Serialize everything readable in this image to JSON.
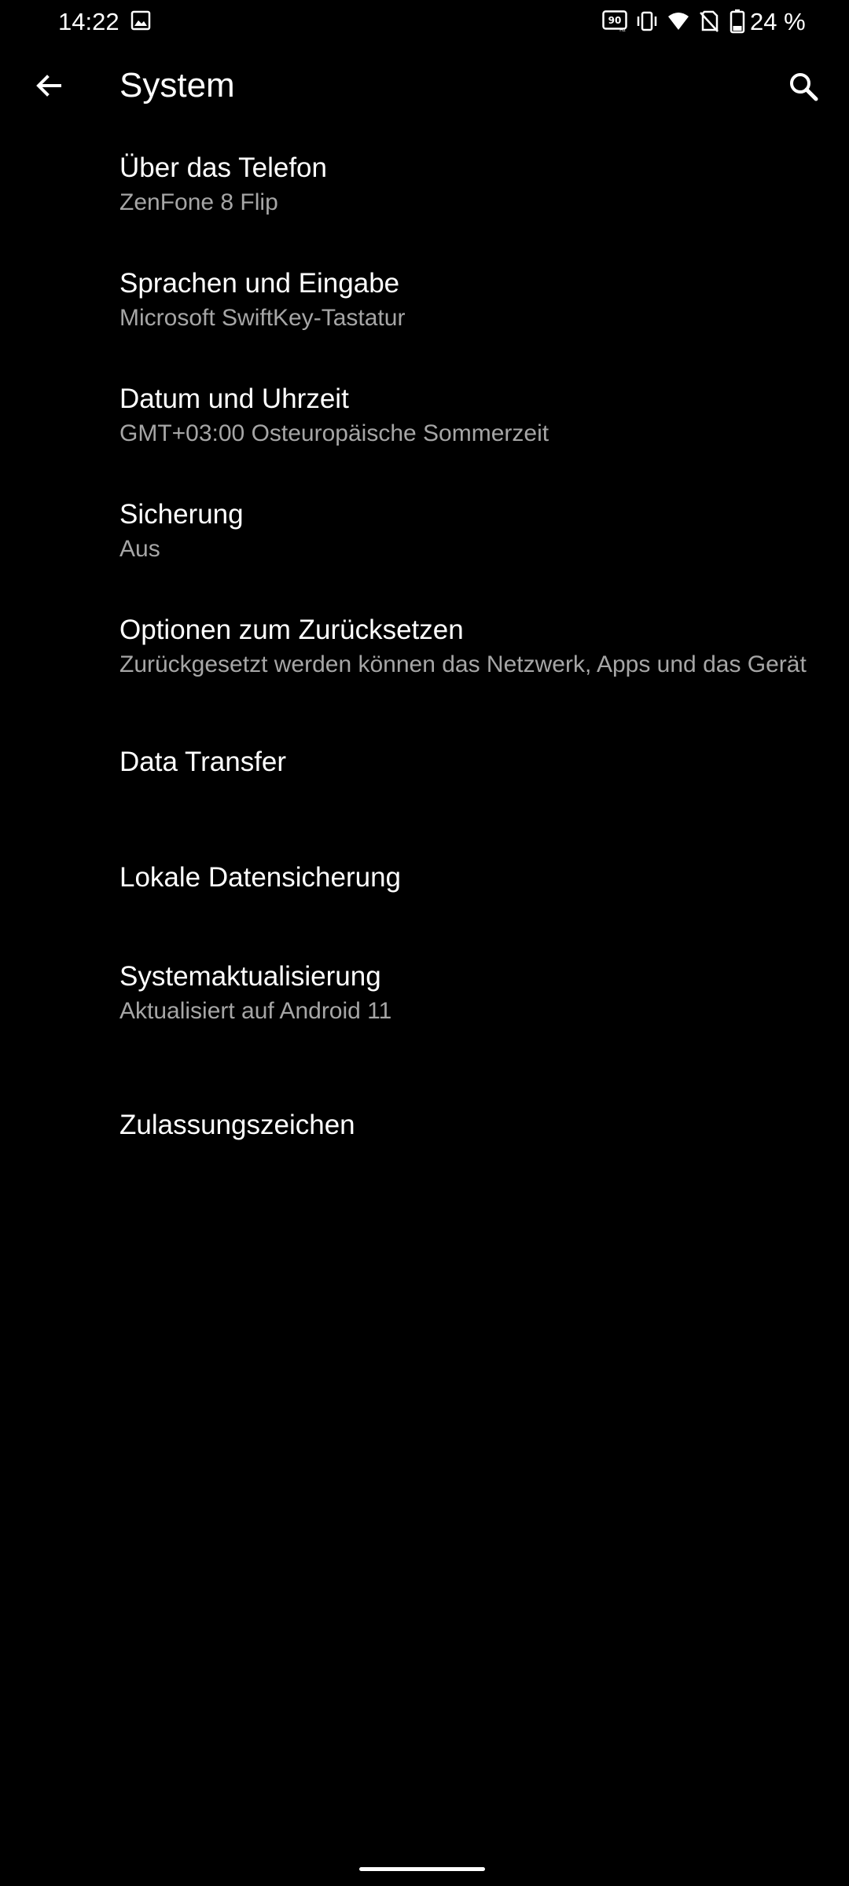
{
  "status_bar": {
    "time": "14:22",
    "battery": "24 %",
    "icons": [
      "gallery-icon",
      "refresh-rate-90hz-icon",
      "vibrate-icon",
      "wifi-icon",
      "no-sim-icon",
      "battery-icon"
    ]
  },
  "app_bar": {
    "title": "System",
    "back_icon": "arrow-left-icon",
    "search_icon": "search-icon"
  },
  "settings": [
    {
      "title": "Über das Telefon",
      "summary": "ZenFone 8 Flip"
    },
    {
      "title": "Sprachen und Eingabe",
      "summary": "Microsoft SwiftKey-Tastatur"
    },
    {
      "title": "Datum und Uhrzeit",
      "summary": "GMT+03:00 Osteuropäische Sommerzeit"
    },
    {
      "title": "Sicherung",
      "summary": "Aus"
    },
    {
      "title": "Optionen zum Zurücksetzen",
      "summary": "Zurückgesetzt werden können das Netzwerk, Apps und das Gerät"
    },
    {
      "title": "Data Transfer",
      "summary": ""
    },
    {
      "title": "Lokale Datensicherung",
      "summary": ""
    },
    {
      "title": "Systemaktualisierung",
      "summary": "Aktualisiert auf Android 11"
    },
    {
      "title": "Zulassungszeichen",
      "summary": ""
    }
  ],
  "colors": {
    "background": "#000000",
    "text_primary": "#ffffff",
    "text_secondary": "#a6a6a6"
  }
}
